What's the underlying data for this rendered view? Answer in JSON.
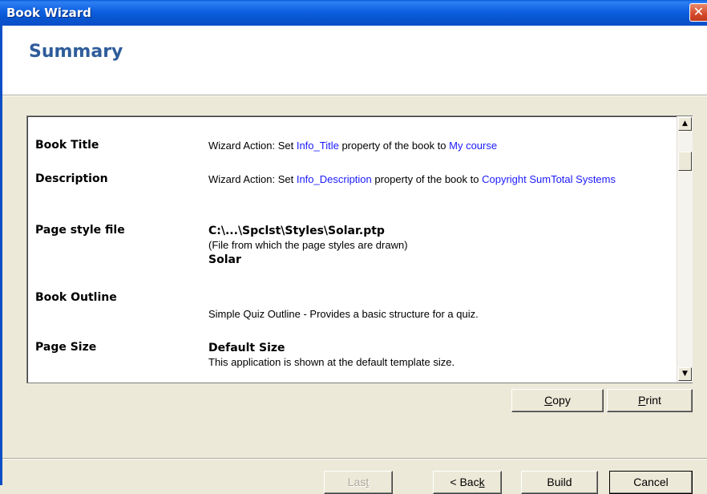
{
  "window": {
    "title": "Book Wizard",
    "close_glyph": "✕"
  },
  "header": {
    "title": "Summary"
  },
  "summary": {
    "rows": [
      {
        "label": "Book Title",
        "prefix": "Wizard Action: Set ",
        "property": "Info_Title",
        "middle": " property of the book to ",
        "value": "My course"
      },
      {
        "label": "Description",
        "prefix": "Wizard Action: Set ",
        "property": "Info_Description",
        "middle": " property of the book to ",
        "value": "Copyright SumTotal Systems"
      },
      {
        "label": "Page style file",
        "path": "C:\\...\\Spclst\\Styles\\Solar.ptp",
        "note": "(File from which the page styles are drawn)",
        "style_name": "Solar"
      },
      {
        "label": "Book Outline",
        "text": "Simple Quiz Outline - Provides a basic structure for a quiz."
      },
      {
        "label": "Page Size",
        "size_name": "Default Size",
        "text": "This application is shown at the default template size."
      }
    ]
  },
  "scrollbar": {
    "up_glyph": "▲",
    "down_glyph": "▼"
  },
  "actions": {
    "copy": {
      "pre": "",
      "key": "C",
      "post": "opy"
    },
    "print": {
      "pre": "",
      "key": "P",
      "post": "rint"
    }
  },
  "footer": {
    "last": {
      "pre": "Las",
      "key": "t",
      "post": ""
    },
    "back": {
      "pre": "< Bac",
      "key": "k",
      "post": ""
    },
    "build": "Build",
    "cancel": "Cancel"
  },
  "colors": {
    "titlebar": "#0a5cd6",
    "header_text": "#2f5c9a",
    "link": "#1a1aff",
    "dialog_bg": "#ece9d8"
  }
}
